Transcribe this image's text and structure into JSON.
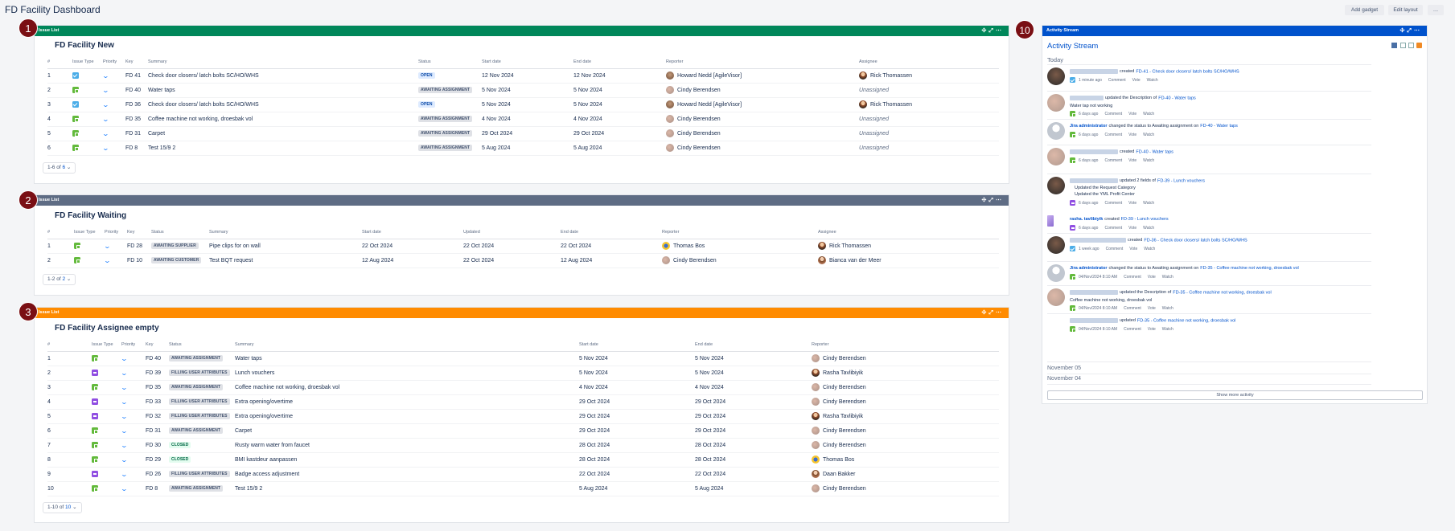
{
  "page": {
    "title": "FD Facility Dashboard"
  },
  "toolbar": {
    "add_gadget": "Add gadget",
    "edit_layout": "Edit layout",
    "more": "…"
  },
  "gadgets": {
    "new": {
      "header": "Issue List",
      "title": "FD Facility New",
      "color": "#00875a",
      "columns": [
        "#",
        "Issue Type",
        "Priority",
        "Key",
        "Summary",
        "Status",
        "Start date",
        "End date",
        "Reporter",
        "Assignee"
      ],
      "rows": [
        {
          "n": "1",
          "type": "task",
          "key": "FD 41",
          "summary": "Check door closers/ latch bolts SC/HO/WHS",
          "status": "OPEN",
          "start": "12 Nov 2024",
          "end": "12 Nov 2024",
          "reporter": "Howard Nedd [AgileVisor]",
          "ravatar": "brown",
          "assignee": "Rick Thomassen",
          "aavatar": "man"
        },
        {
          "n": "2",
          "type": "svc",
          "key": "FD 40",
          "summary": "Water taps",
          "status": "AWAITING ASSIGNMENT",
          "start": "5 Nov 2024",
          "end": "5 Nov 2024",
          "reporter": "Cindy Berendsen",
          "ravatar": "blur",
          "assignee": "Unassigned",
          "aavatar": ""
        },
        {
          "n": "3",
          "type": "task",
          "key": "FD 36",
          "summary": "Check door closers/ latch bolts SC/HO/WHS",
          "status": "OPEN",
          "start": "5 Nov 2024",
          "end": "5 Nov 2024",
          "reporter": "Howard Nedd [AgileVisor]",
          "ravatar": "brown",
          "assignee": "Rick Thomassen",
          "aavatar": "man"
        },
        {
          "n": "4",
          "type": "svc",
          "key": "FD 35",
          "summary": "Coffee machine not working, droesbak vol",
          "status": "AWAITING ASSIGNMENT",
          "start": "4 Nov 2024",
          "end": "4 Nov 2024",
          "reporter": "Cindy Berendsen",
          "ravatar": "blur",
          "assignee": "Unassigned",
          "aavatar": ""
        },
        {
          "n": "5",
          "type": "svc",
          "key": "FD 31",
          "summary": "Carpet",
          "status": "AWAITING ASSIGNMENT",
          "start": "29 Oct 2024",
          "end": "29 Oct 2024",
          "reporter": "Cindy Berendsen",
          "ravatar": "blur",
          "assignee": "Unassigned",
          "aavatar": ""
        },
        {
          "n": "6",
          "type": "svc",
          "key": "FD 8",
          "summary": "Test 15/9    2",
          "status": "AWAITING ASSIGNMENT",
          "start": "5 Aug 2024",
          "end": "5 Aug 2024",
          "reporter": "Cindy Berendsen",
          "ravatar": "blur",
          "assignee": "Unassigned",
          "aavatar": ""
        }
      ],
      "pager": {
        "range": "1-6 of ",
        "total": "6"
      }
    },
    "waiting": {
      "header": "Issue List",
      "title": "FD Facility Waiting",
      "color": "#5e6c84",
      "columns": [
        "#",
        "Issue Type",
        "Priority",
        "Key",
        "Status",
        "Summary",
        "Start date",
        "Updated",
        "End date",
        "Reporter",
        "Assignee"
      ],
      "rows": [
        {
          "n": "1",
          "type": "svc",
          "key": "FD 28",
          "status": "AWAITING SUPPLIER",
          "summary": "Pipe clips for on wall",
          "start": "22 Oct 2024",
          "updated": "22 Oct 2024",
          "end": "22 Oct 2024",
          "reporter": "Thomas Bos",
          "ravatar": "yellow",
          "assignee": "Rick Thomassen",
          "aavatar": "man"
        },
        {
          "n": "2",
          "type": "svc",
          "key": "FD 10",
          "status": "AWAITING CUSTOMER",
          "summary": "Test BQT request",
          "start": "12 Aug 2024",
          "updated": "22 Oct 2024",
          "end": "12 Aug 2024",
          "reporter": "Cindy Berendsen",
          "ravatar": "blur",
          "assignee": "Bianca van der Meer",
          "aavatar": "woman"
        }
      ],
      "pager": {
        "range": "1-2 of ",
        "total": "2"
      }
    },
    "empty": {
      "header": "Issue List",
      "title": "FD Facility Assignee empty",
      "color": "#ff8b00",
      "columns": [
        "#",
        "Issue Type",
        "Priority",
        "Key",
        "Status",
        "Summary",
        "Start date",
        "End date",
        "Reporter"
      ],
      "rows": [
        {
          "n": "1",
          "type": "svc",
          "key": "FD 40",
          "status": "AWAITING ASSIGNMENT",
          "summary": "Water taps",
          "start": "5 Nov 2024",
          "end": "5 Nov 2024",
          "reporter": "Cindy Berendsen",
          "ravatar": "blur"
        },
        {
          "n": "2",
          "type": "pur",
          "key": "FD 39",
          "status": "FILLING USER ATTRIBUTES",
          "summary": "Lunch vouchers",
          "start": "5 Nov 2024",
          "end": "5 Nov 2024",
          "reporter": "Rasha Tavlibiyik",
          "ravatar": "man"
        },
        {
          "n": "3",
          "type": "svc",
          "key": "FD 35",
          "status": "AWAITING ASSIGNMENT",
          "summary": "Coffee machine not working, droesbak vol",
          "start": "4 Nov 2024",
          "end": "4 Nov 2024",
          "reporter": "Cindy Berendsen",
          "ravatar": "blur"
        },
        {
          "n": "4",
          "type": "pur",
          "key": "FD 33",
          "status": "FILLING USER ATTRIBUTES",
          "summary": "Extra opening/overtime",
          "start": "29 Oct 2024",
          "end": "29 Oct 2024",
          "reporter": "Cindy Berendsen",
          "ravatar": "blur"
        },
        {
          "n": "5",
          "type": "pur",
          "key": "FD 32",
          "status": "FILLING USER ATTRIBUTES",
          "summary": "Extra opening/overtime",
          "start": "29 Oct 2024",
          "end": "29 Oct 2024",
          "reporter": "Rasha Tavlibiyik",
          "ravatar": "man"
        },
        {
          "n": "6",
          "type": "svc",
          "key": "FD 31",
          "status": "AWAITING ASSIGNMENT",
          "summary": "Carpet",
          "start": "29 Oct 2024",
          "end": "29 Oct 2024",
          "reporter": "Cindy Berendsen",
          "ravatar": "blur"
        },
        {
          "n": "7",
          "type": "svc",
          "key": "FD 30",
          "status": "CLOSED",
          "summary": "Rusty warm water from faucet",
          "start": "28 Oct 2024",
          "end": "28 Oct 2024",
          "reporter": "Cindy Berendsen",
          "ravatar": "blur"
        },
        {
          "n": "8",
          "type": "svc",
          "key": "FD 29",
          "status": "CLOSED",
          "summary": "BMI kastdeur aanpassen",
          "start": "28 Oct 2024",
          "end": "28 Oct 2024",
          "reporter": "Thomas Bos",
          "ravatar": "yellow"
        },
        {
          "n": "9",
          "type": "pur",
          "key": "FD 26",
          "status": "FILLING USER ATTRIBUTES",
          "summary": "Badge access adjustment",
          "start": "22 Oct 2024",
          "end": "22 Oct 2024",
          "reporter": "Daan Bakker",
          "ravatar": "woman"
        },
        {
          "n": "10",
          "type": "svc",
          "key": "FD 8",
          "status": "AWAITING ASSIGNMENT",
          "summary": "Test 15/9    2",
          "start": "5 Aug 2024",
          "end": "5 Aug 2024",
          "reporter": "Cindy Berendsen",
          "ravatar": "blur"
        }
      ],
      "pager": {
        "range": "1-10 of ",
        "total": "10"
      }
    }
  },
  "activity": {
    "header": "Activity Stream",
    "title": "Activity Stream",
    "color": "#0052cc",
    "today": "Today",
    "nov05": "November 05",
    "nov04": "November 04",
    "show_more": "Show more activity",
    "actions": {
      "comment": "Comment",
      "vote": "Vote",
      "watch": "Watch"
    },
    "items": [
      {
        "action": "created",
        "link": "FD-41 - Check door closers/ latch bolts SC/HO/WHS",
        "time": "1 minute ago",
        "type": "task"
      },
      {
        "action": "updated the Description of",
        "link": "FD-40 - Water taps",
        "detail": "Water tap not working",
        "time": "6 days ago",
        "type": "svc"
      },
      {
        "who": "Jira administrator",
        "action": "changed the status to Awaiting assignment on",
        "link": "FD-40 - Water taps",
        "time": "6 days ago",
        "type": "svc"
      },
      {
        "action": "created",
        "link": "FD-40 - Water taps",
        "time": "6 days ago",
        "type": "svc"
      },
      {
        "action": "updated 2 fields of",
        "link": "FD-39 - Lunch vouchers",
        "bullets": [
          "Updated the Request Category",
          "Updated the YML Profit Center"
        ],
        "time": "6 days ago",
        "type": "pur"
      },
      {
        "who": "rasha. tavlibiyik",
        "action": "created",
        "link": "FD-39 - Lunch vouchers",
        "time": "6 days ago",
        "type": "pur"
      },
      {
        "action": "created",
        "link": "FD-36 - Check door closers/ latch bolts SC/HO/WHS",
        "time": "1 week ago",
        "type": "task"
      },
      {
        "who": "Jira administrator",
        "action": "changed the status to Awaiting assignment on",
        "link": "FD-35 - Coffee machine not working, droesbak vol",
        "time": "04/Nov/2024 8:10 AM",
        "type": "svc"
      },
      {
        "action": "updated the Description of",
        "link": "FD-35 - Coffee machine not working, droesbak vol",
        "detail": "Coffee machine not working, droesbak vol",
        "time": "04/Nov/2024 8:10 AM",
        "type": "svc"
      },
      {
        "action": "updated",
        "link": "FD-35 - Coffee machine not working, droesbak vol",
        "time": "04/Nov/2024 8:10 AM",
        "type": "svc"
      }
    ]
  },
  "badges": {
    "b1": "1",
    "b2": "2",
    "b3": "3",
    "b10": "10"
  }
}
